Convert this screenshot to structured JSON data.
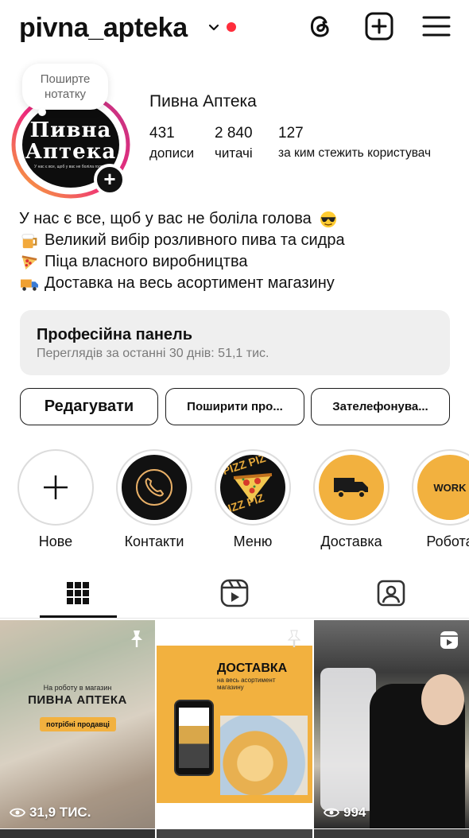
{
  "header": {
    "username": "pivna_apteka",
    "icons": [
      "chevron-down-icon",
      "threads-icon",
      "create-post-icon",
      "menu-icon"
    ]
  },
  "note": {
    "placeholder": "Поширте нотатку"
  },
  "avatar": {
    "line1": "Пивна",
    "line2": "Аптека",
    "line3": "У нас є все, щоб у вас не боліла голова"
  },
  "profile": {
    "display_name": "Пивна Аптека",
    "stats": [
      {
        "value": "431",
        "label": "дописи"
      },
      {
        "value": "2 840",
        "label": "читачі"
      },
      {
        "value": "127",
        "label": "за ким стежить користувач"
      }
    ],
    "bio": [
      {
        "text": "У нас є все, щоб у вас не боліла голова",
        "emoji": "sunglasses-emoji",
        "emoji_position": "end"
      },
      {
        "text": "Великий вибір розливного пива та сидра",
        "emoji": "beer-mug-emoji",
        "emoji_position": "start"
      },
      {
        "text": "Піца власного виробництва",
        "emoji": "pizza-emoji",
        "emoji_position": "start"
      },
      {
        "text": "Доставка на весь асортимент магазину",
        "emoji": "delivery-truck-emoji",
        "emoji_position": "start"
      }
    ]
  },
  "pro_panel": {
    "title": "Професійна панель",
    "subtitle": "Переглядів за останні 30 днів: 51,1 тис."
  },
  "buttons": {
    "edit": "Редагувати",
    "share": "Поширити про...",
    "call": "Зателефонува..."
  },
  "highlights": [
    {
      "label": "Нове",
      "icon": "plus-icon"
    },
    {
      "label": "Контакти",
      "icon": "phone-icon"
    },
    {
      "label": "Меню",
      "icon": "pizza-icon",
      "art_text": "PIZZ PIZ"
    },
    {
      "label": "Доставка",
      "icon": "truck-icon"
    },
    {
      "label": "Робота",
      "icon": "work-icon",
      "art_text": "WORK"
    }
  ],
  "tabs": [
    {
      "name": "grid",
      "icon": "grid-icon",
      "active": true
    },
    {
      "name": "reels",
      "icon": "reels-icon",
      "active": false
    },
    {
      "name": "tagged",
      "icon": "tagged-user-icon",
      "active": false
    }
  ],
  "posts": [
    {
      "pinned": true,
      "views": "31,9 ТИС.",
      "caption_small": "На роботу в магазин",
      "caption_big": "ПИВНА АПТЕКА",
      "badge": "потрібні продавці"
    },
    {
      "pinned": true,
      "views": "",
      "caption_big": "ДОСТАВКА",
      "caption_small": "на весь асортимент магазину"
    },
    {
      "reel": true,
      "views": "994"
    }
  ],
  "colors": {
    "accent_red": "#ff2d3b",
    "brand_yellow": "#f2b13f",
    "panel_bg": "#efefef"
  }
}
